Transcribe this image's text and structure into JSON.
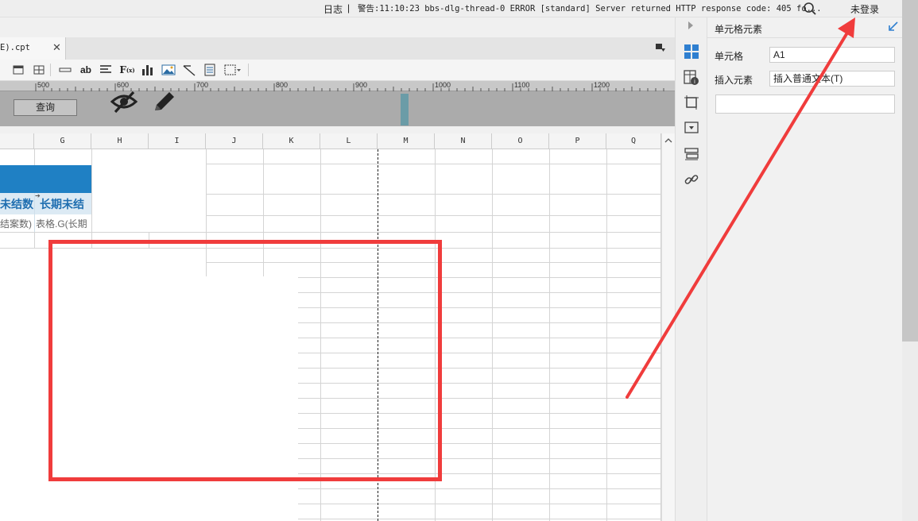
{
  "status_bar": {
    "log_label": "日志",
    "separator": "|",
    "message": "警告:11:10:23 bbs-dlg-thread-0 ERROR [standard] Server returned HTTP response code: 405 fo...",
    "search_icon": "search-icon",
    "login_label": "未登录"
  },
  "tab": {
    "title": "E).cpt",
    "close": "✕"
  },
  "ruler": {
    "labels": [
      "500",
      "600",
      "700",
      "800",
      "900",
      "1000",
      "1100",
      "1200"
    ]
  },
  "param_panel": {
    "query_button": "查询"
  },
  "grid": {
    "columns": [
      "G",
      "H",
      "I",
      "J",
      "K",
      "L",
      "M",
      "N",
      "O",
      "P",
      "Q"
    ],
    "header_cells": [
      "未结数",
      "长期未结"
    ],
    "sub_cells": [
      "结案数)",
      "表格.G(长期"
    ]
  },
  "properties": {
    "title": "单元格元素",
    "cell_label": "单元格",
    "cell_value": "A1",
    "insert_label": "插入元素",
    "insert_value": "插入普通文本(T)"
  },
  "colors": {
    "accent_blue": "#1f80c4",
    "annotation_red": "#f03c3c",
    "teal_marker": "#6b9ca7"
  }
}
